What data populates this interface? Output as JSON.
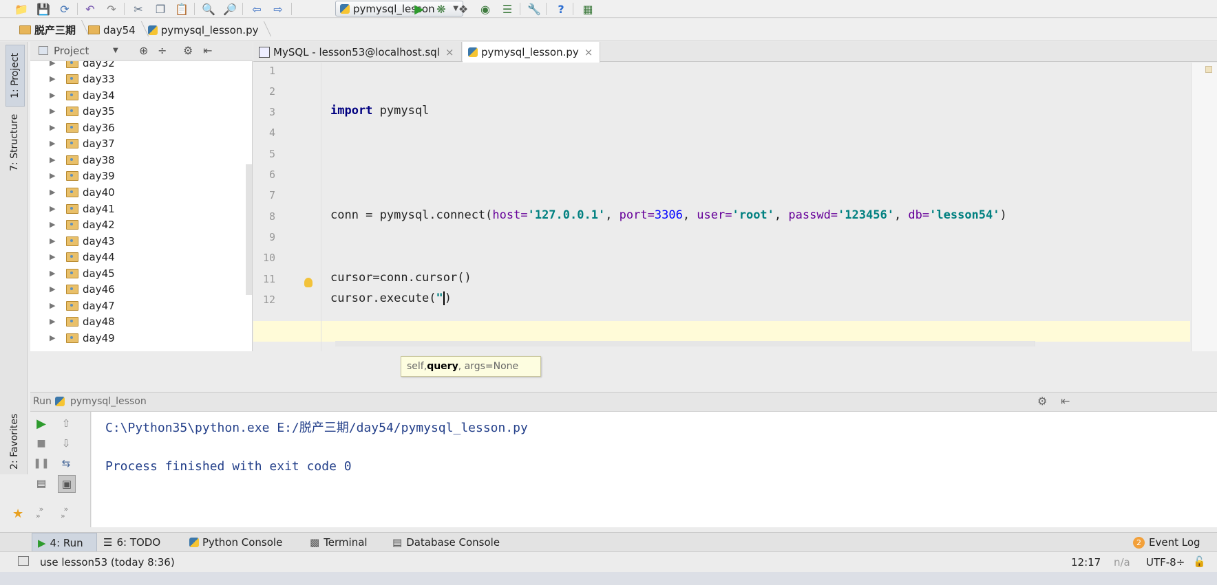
{
  "toolbar": {
    "run_config": "pymysql_lesson",
    "colors": {
      "run": "#2e9b2e",
      "debug": "#3d7a3d"
    },
    "icons": [
      "open-icon",
      "save-icon",
      "sync-icon",
      "undo-icon",
      "redo-icon",
      "cut-icon",
      "copy-icon",
      "paste-icon",
      "find-icon",
      "replace-icon",
      "back-icon",
      "forward-icon",
      "run-icon",
      "debug-icon",
      "coverage-icon",
      "profile-icon",
      "concurrency-icon",
      "settings-icon",
      "help-icon",
      "vcs-icon"
    ]
  },
  "breadcrumb": [
    "脱产三期",
    "day54",
    "pymysql_lesson.py"
  ],
  "side_tabs": {
    "project": "1: Project",
    "structure": "7: Structure",
    "favorites": "2: Favorites"
  },
  "project_panel": {
    "title": "Project",
    "items": [
      "day32",
      "day33",
      "day34",
      "day35",
      "day36",
      "day37",
      "day38",
      "day39",
      "day40",
      "day41",
      "day42",
      "day43",
      "day44",
      "day45",
      "day46",
      "day47",
      "day48",
      "day49"
    ]
  },
  "editor_tabs": [
    {
      "label": "MySQL - lesson53@localhost.sql",
      "active": false
    },
    {
      "label": "pymysql_lesson.py",
      "active": true
    }
  ],
  "editor": {
    "line_numbers": [
      "1",
      "2",
      "3",
      "4",
      "5",
      "6",
      "7",
      "8",
      "9",
      "10",
      "11",
      "12"
    ],
    "line3": {
      "kw": "import",
      "rest": " pymysql"
    },
    "line8": {
      "prefix": "conn = pymysql.connect(",
      "host_k": "host=",
      "host_v": "'127.0.0.1'",
      "port_k": "port=",
      "port_v": "3306",
      "user_k": "user=",
      "user_v": "'root'",
      "pw_k": "passwd=",
      "pw_v": "'123456'",
      "db_k": "db=",
      "db_v": "'lesson54'",
      "sep": ", ",
      "close": ")"
    },
    "line11": "cursor=conn.cursor()",
    "line12": {
      "prefix": "cursor.execute(",
      "cursor_text": "\"",
      "close": ")"
    },
    "tooltip": {
      "before": "self, ",
      "bold": "query",
      "after": ", args=None"
    }
  },
  "run_panel": {
    "label": "Run",
    "config": "pymysql_lesson",
    "output": [
      "C:\\Python35\\python.exe E:/脱产三期/day54/pymysql_lesson.py",
      "Process finished with exit code 0"
    ]
  },
  "bottom_tabs": [
    {
      "label": "4: Run",
      "icon": "run-icon"
    },
    {
      "label": "6: TODO",
      "icon": "todo-icon"
    },
    {
      "label": "Python Console",
      "icon": "python-icon"
    },
    {
      "label": "Terminal",
      "icon": "terminal-icon"
    },
    {
      "label": "Database Console",
      "icon": "database-icon"
    }
  ],
  "event_log": {
    "count": "2",
    "label": "Event Log"
  },
  "status": {
    "message": "use lesson53 (today 8:36)",
    "position": "12:17",
    "na": "n/a",
    "encoding": "UTF-8÷"
  }
}
